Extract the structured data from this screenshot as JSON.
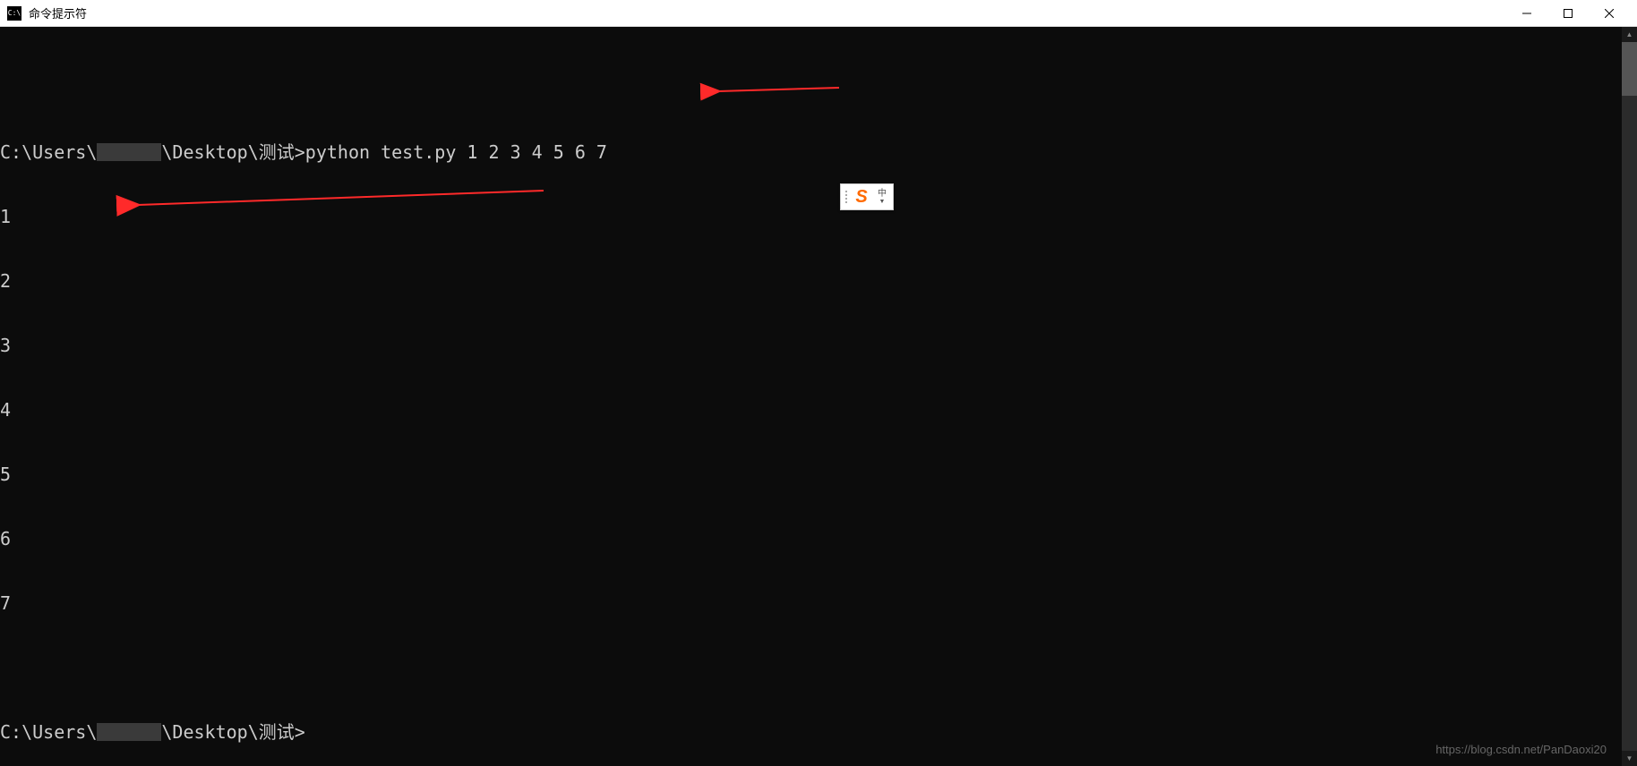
{
  "window": {
    "title": "命令提示符",
    "icon_label": "C:\\"
  },
  "terminal": {
    "prompt1_prefix": "C:\\Users\\",
    "prompt1_suffix": "\\Desktop\\测试>",
    "command": "python test.py 1 2 3 4 5 6 7",
    "output": [
      "1",
      "2",
      "3",
      "4",
      "5",
      "6",
      "7"
    ],
    "prompt2_prefix": "C:\\Users\\",
    "prompt2_suffix": "\\Desktop\\测试>"
  },
  "ime": {
    "logo_letter": "S",
    "mode_symbol": "中"
  },
  "watermark": "https://blog.csdn.net/PanDaoxi20",
  "annotations": {
    "arrow_color": "#ff2a2a"
  }
}
